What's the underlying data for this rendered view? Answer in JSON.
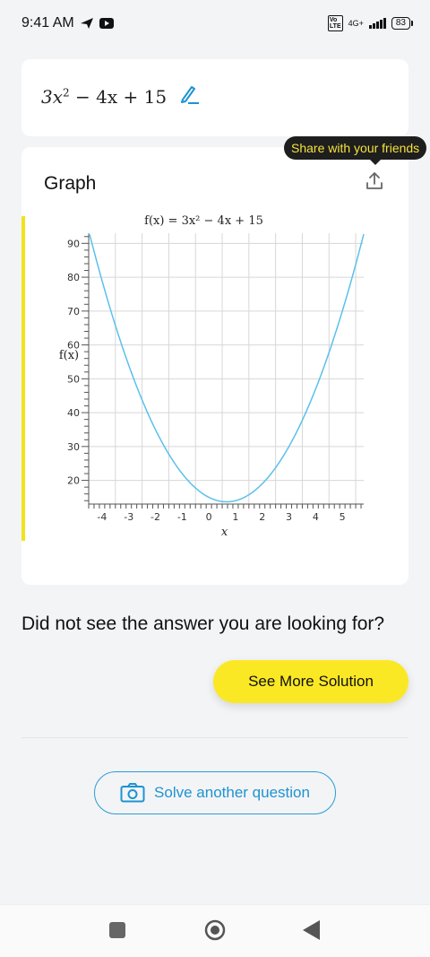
{
  "status_bar": {
    "time": "9:41 AM",
    "network": "4G+",
    "battery": "83"
  },
  "equation": {
    "coef_a": "3x",
    "exp": "2",
    "rest": " − 4x + 15"
  },
  "graph": {
    "title": "Graph",
    "tooltip": "Share with your friends"
  },
  "chart_data": {
    "type": "line",
    "title": "f(x) = 3x² − 4x + 15",
    "xlabel": "x",
    "ylabel": "f(x)",
    "function": "3x^2 - 4x + 15",
    "xlim": [
      -4.5,
      5.8
    ],
    "ylim": [
      13,
      93
    ],
    "xticks": [
      -4,
      -3,
      -2,
      -1,
      0,
      1,
      2,
      3,
      4,
      5
    ],
    "yticks": [
      20,
      30,
      40,
      50,
      60,
      70,
      80,
      90
    ],
    "x": [
      -4.5,
      -4,
      -3,
      -2,
      -1,
      0,
      0.667,
      1,
      2,
      3,
      4,
      5,
      5.8
    ],
    "y": [
      93.75,
      79,
      54,
      35,
      22,
      15,
      13.67,
      14,
      19,
      30,
      47,
      70,
      92.72
    ],
    "line_color": "#5bc0eb",
    "grid": true
  },
  "question": "Did not see the answer you are looking for?",
  "see_more_label": "See More Solution",
  "solve_another_label": "Solve another question",
  "colors": {
    "accent_yellow": "#fbe824",
    "accent_blue": "#1d93d2"
  }
}
